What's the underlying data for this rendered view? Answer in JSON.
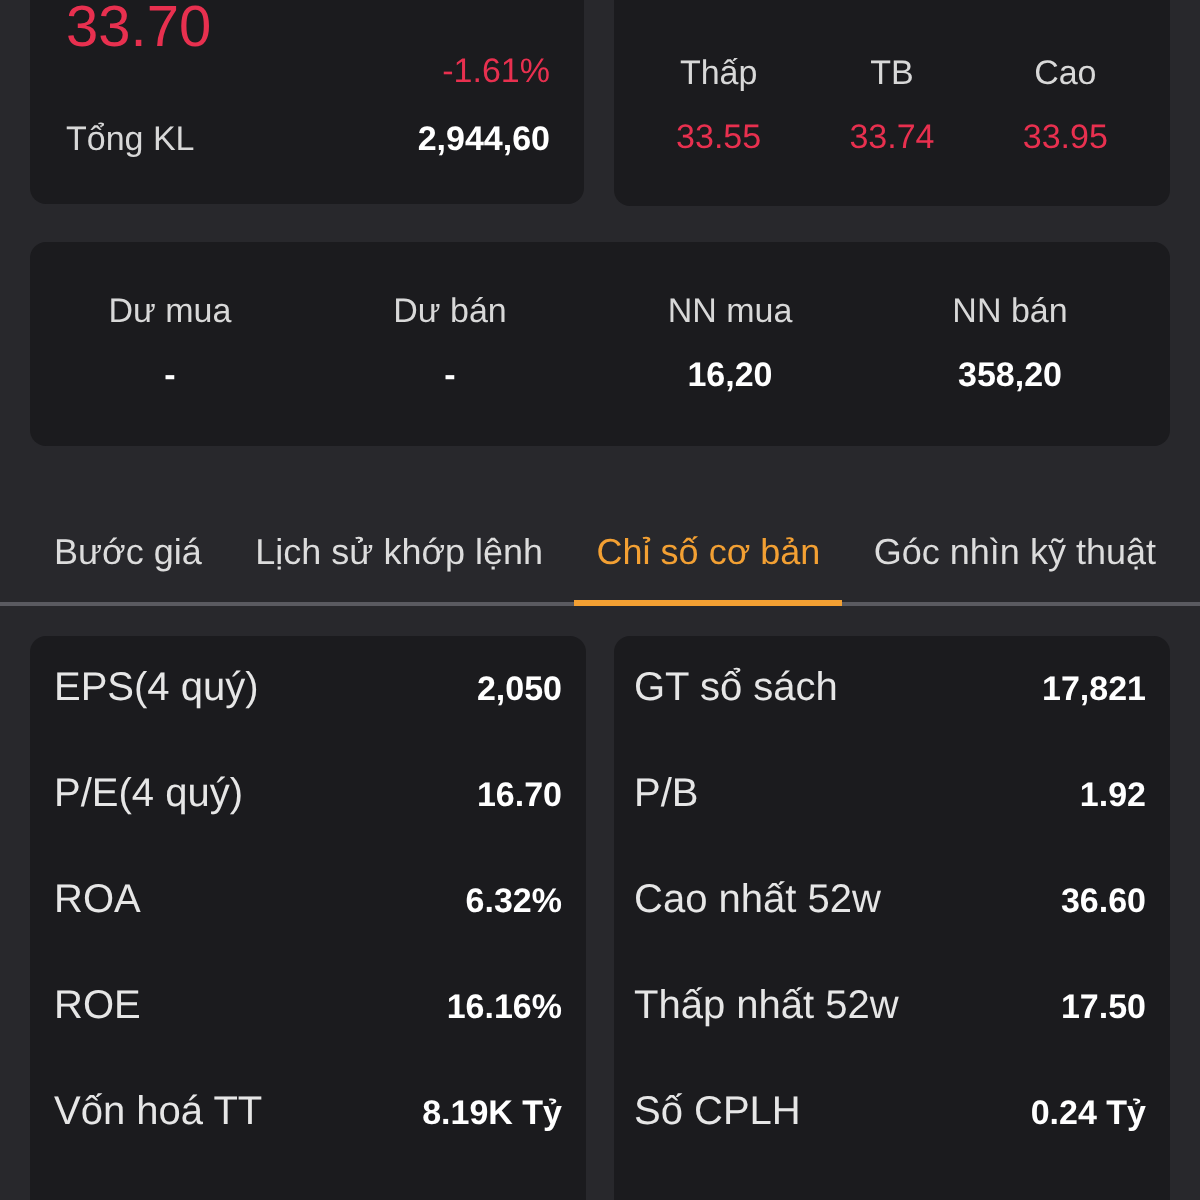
{
  "quote": {
    "price": "33.70",
    "change_percent": "-1.61%",
    "falling": true,
    "total_volume": {
      "label": "Tổng KL",
      "value": "2,944,60"
    }
  },
  "range": [
    {
      "label": "Thấp",
      "value": "33.55",
      "falling": true
    },
    {
      "label": "TB",
      "value": "33.74",
      "falling": true
    },
    {
      "label": "Cao",
      "value": "33.95",
      "falling": true
    }
  ],
  "orders": [
    {
      "label": "Dư mua",
      "value": "-"
    },
    {
      "label": "Dư bán",
      "value": "-"
    },
    {
      "label": "NN mua",
      "value": "16,20"
    },
    {
      "label": "NN bán",
      "value": "358,20"
    }
  ],
  "tabs": [
    {
      "label": "Bước giá",
      "selected": false
    },
    {
      "label": "Lịch sử khớp lệnh",
      "selected": false
    },
    {
      "label": "Chỉ số cơ bản",
      "selected": true
    },
    {
      "label": "Góc nhìn kỹ thuật",
      "selected": false
    }
  ],
  "fundamentals": {
    "left": [
      {
        "label": "EPS(4 quý)",
        "value": "2,050"
      },
      {
        "label": "P/E(4 quý)",
        "value": "16.70"
      },
      {
        "label": "ROA",
        "value": "6.32%"
      },
      {
        "label": "ROE",
        "value": "16.16%"
      },
      {
        "label": "Vốn hoá TT",
        "value": "8.19K Tỷ"
      }
    ],
    "right": [
      {
        "label": "GT sổ sách",
        "value": "17,821"
      },
      {
        "label": "P/B",
        "value": "1.92"
      },
      {
        "label": "Cao nhất 52w",
        "value": "36.60"
      },
      {
        "label": "Thấp nhất 52w",
        "value": "17.50"
      },
      {
        "label": "Số CPLH",
        "value": "0.24 Tỷ"
      }
    ]
  }
}
